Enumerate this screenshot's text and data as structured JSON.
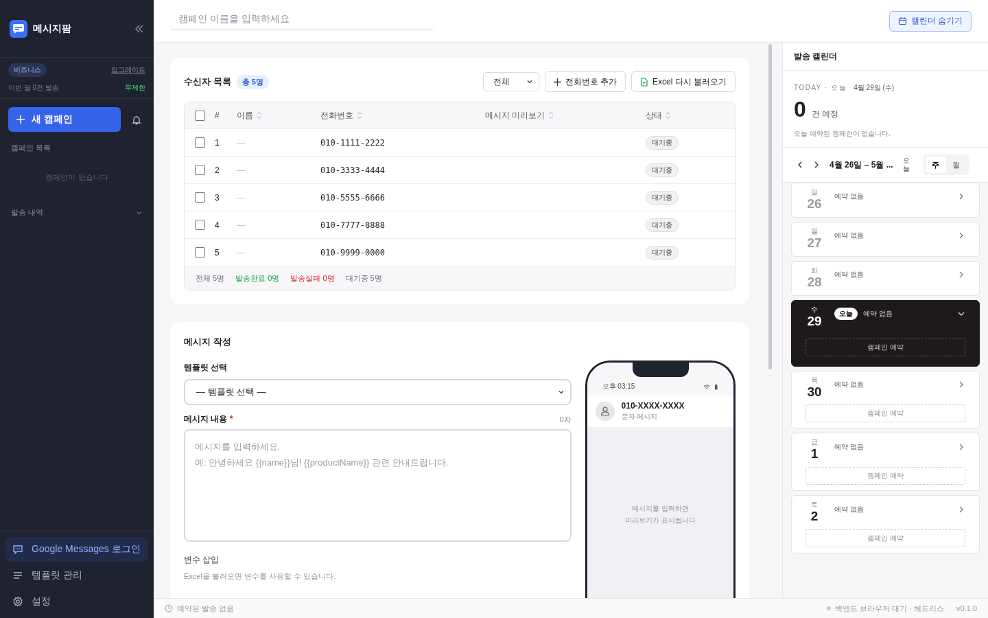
{
  "sidebar": {
    "app_name": "메시지팜",
    "plan": {
      "badge": "비즈니스",
      "upgrade": "업그레이드",
      "usage": "이번 달 0건 발송",
      "limit": "무제한"
    },
    "new_campaign": "새 캠페인",
    "campaign_list": {
      "title": "캠페인 목록",
      "empty": "캠페인이 없습니다"
    },
    "history": {
      "title": "발송 내역",
      "expanded": false
    },
    "bottom_items": [
      {
        "label": "Google Messages 로그인",
        "selected": true
      },
      {
        "label": "템플릿 관리",
        "selected": false
      },
      {
        "label": "설정",
        "selected": false
      }
    ]
  },
  "topbar": {
    "campaign_name_placeholder": "캠페인 이름을 입력하세요",
    "calendar_toggle": "캘린더 숨기기"
  },
  "recipients": {
    "title": "수신자 목록",
    "count_badge": "총 5명",
    "filter": "전체",
    "add_phone": "전화번호 추가",
    "reload_excel": "Excel 다시 불러오기",
    "select_all_checked": false,
    "columns": [
      "#",
      "이름",
      "전화번호",
      "메시지 미리보기",
      "상태"
    ],
    "rows": [
      {
        "no": "1",
        "name": "—",
        "phone": "010-1111-2222",
        "status": "대기중",
        "checked": false
      },
      {
        "no": "2",
        "name": "—",
        "phone": "010-3333-4444",
        "status": "대기중",
        "checked": false
      },
      {
        "no": "3",
        "name": "—",
        "phone": "010-5555-6666",
        "status": "대기중",
        "checked": false
      },
      {
        "no": "4",
        "name": "—",
        "phone": "010-7777-8888",
        "status": "대기중",
        "checked": false
      },
      {
        "no": "5",
        "name": "—",
        "phone": "010-9999-0000",
        "status": "대기중",
        "checked": false
      }
    ],
    "summary": [
      {
        "text": "전체 5명",
        "kind": "total"
      },
      {
        "text": "발송완료 0명",
        "kind": "sent"
      },
      {
        "text": "발송실패 0명",
        "kind": "failed"
      },
      {
        "text": "대기중 5명",
        "kind": "waiting"
      }
    ]
  },
  "compose": {
    "title": "메시지 작성",
    "template_label": "템플릿 선택",
    "template_value": "— 템플릿 선택 —",
    "content_label": "메시지 내용",
    "required_mark": "*",
    "char_count": "0자",
    "content_placeholder": "메시지를 입력하세요.\n예: 안녕하세요 {{name}}님! {{productName}} 관련 안내드립니다.",
    "variables_label": "변수 삽입",
    "variables_hint": "Excel을 불러오면 변수를 사용할 수 있습니다.",
    "phone": {
      "time": "오후 03:15",
      "contact": "010-XXXX-XXXX",
      "subtitle": "문자 메시지",
      "empty": "메시지를 입력하면\n미리보기가 표시됩니다"
    }
  },
  "calendar": {
    "title": "발송 캘린더",
    "today_label": "TODAY · 오늘",
    "today_date": "4월 29일 (수)",
    "count": "0",
    "count_unit": "건 예정",
    "today_note": "오늘 예약된 캠페인이 없습니다.",
    "range": "4월 26일 – 5월 ...",
    "today_button": "오늘",
    "views": [
      {
        "label": "주",
        "selected": true
      },
      {
        "label": "월",
        "selected": false
      }
    ],
    "days": [
      {
        "weekday": "일",
        "day": "26",
        "kind": "past",
        "status": "예약 없음"
      },
      {
        "weekday": "월",
        "day": "27",
        "kind": "past",
        "status": "예약 없음"
      },
      {
        "weekday": "화",
        "day": "28",
        "kind": "past",
        "status": "예약 없음"
      },
      {
        "weekday": "수",
        "day": "29",
        "kind": "today",
        "badge": "오늘",
        "status": "예약 없음",
        "reserve": "캠페인 예약"
      },
      {
        "weekday": "목",
        "day": "30",
        "kind": "future",
        "status": "예약 없음",
        "reserve": "캠페인 예약"
      },
      {
        "weekday": "금",
        "day": "1",
        "kind": "future",
        "status": "예약 없음",
        "reserve": "캠페인 예약"
      },
      {
        "weekday": "토",
        "day": "2",
        "kind": "future",
        "status": "예약 없음",
        "reserve": "캠페인 예약"
      }
    ]
  },
  "status_bar": {
    "schedule": "예약된 발송 없음",
    "backend": "백엔드 브라우저 대기 · 헤드리스",
    "version": "v0.1.0"
  }
}
